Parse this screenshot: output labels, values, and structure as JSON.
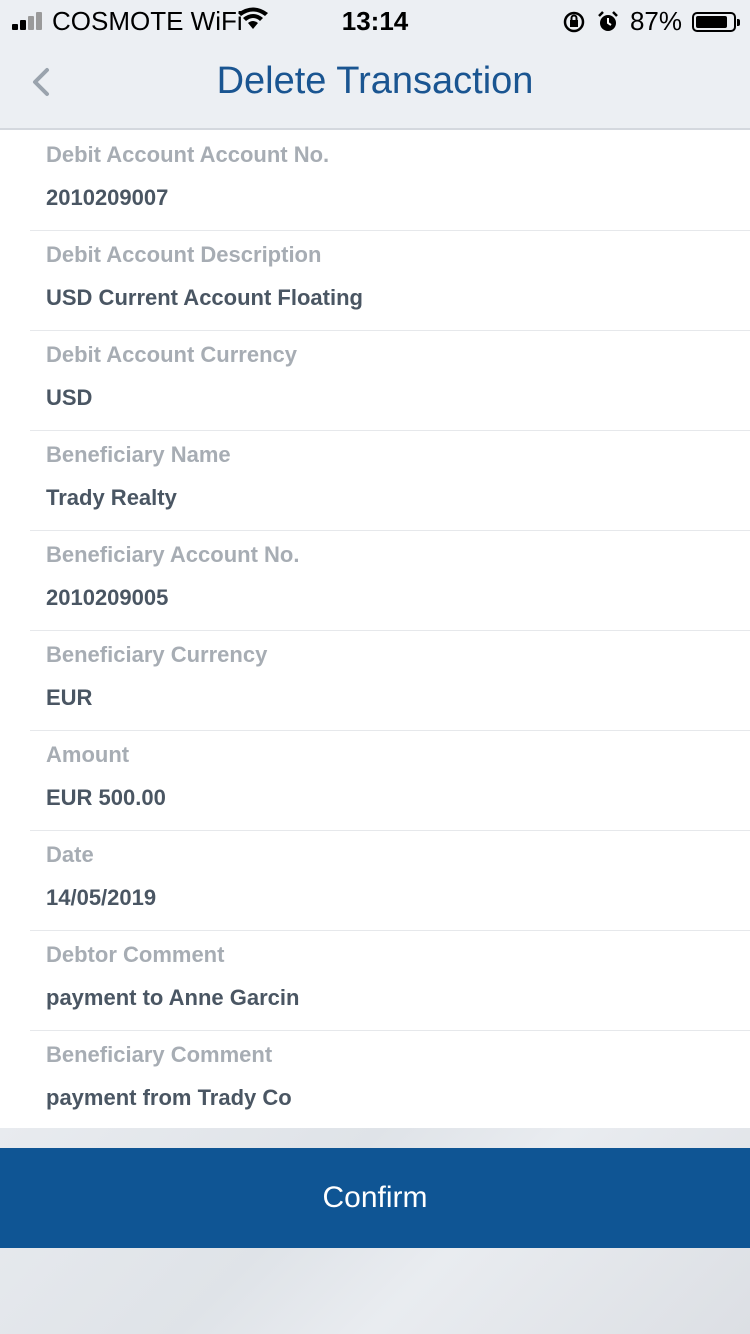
{
  "status_bar": {
    "carrier": "COSMOTE WiFi",
    "time": "13:14",
    "battery": "87%",
    "battery_level": 0.87
  },
  "header": {
    "title": "Delete Transaction"
  },
  "details": [
    {
      "label": "Debit Account Account No.",
      "value": "2010209007"
    },
    {
      "label": "Debit Account Description",
      "value": "USD Current Account Floating"
    },
    {
      "label": "Debit Account Currency",
      "value": "USD"
    },
    {
      "label": "Beneficiary Name",
      "value": "Trady Realty"
    },
    {
      "label": "Beneficiary Account No.",
      "value": "2010209005"
    },
    {
      "label": "Beneficiary Currency",
      "value": "EUR"
    },
    {
      "label": "Amount",
      "value": "EUR 500.00"
    },
    {
      "label": "Date",
      "value": "14/05/2019"
    },
    {
      "label": "Debtor Comment",
      "value": "payment to Anne Garcin"
    },
    {
      "label": "Beneficiary Comment",
      "value": "payment from Trady Co"
    }
  ],
  "footer": {
    "confirm_label": "Confirm"
  },
  "colors": {
    "accent": "#0f5594",
    "title": "#1a5591",
    "label": "#a7adb4",
    "value": "#4a5663"
  }
}
